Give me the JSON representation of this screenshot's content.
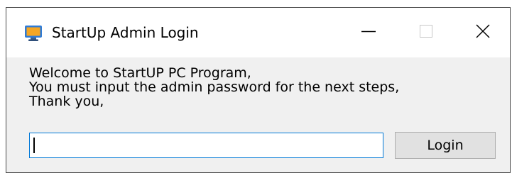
{
  "window": {
    "title": "StartUp Admin Login",
    "app_icon": "monitor-app-icon",
    "controls": {
      "minimize_icon": "minimize-icon",
      "maximize_icon": "maximize-icon",
      "close_icon": "close-icon"
    }
  },
  "message": {
    "line1": "Welcome to StartUP PC Program,",
    "line2": "You must input the admin password for the next steps,",
    "line3": "Thank you,"
  },
  "password_field": {
    "value": "",
    "placeholder": ""
  },
  "login_button": {
    "label": "Login"
  },
  "colors": {
    "input_focus_border": "#0078d7",
    "button_bg": "#e1e1e1",
    "dialog_bg": "#f0f0f0"
  }
}
